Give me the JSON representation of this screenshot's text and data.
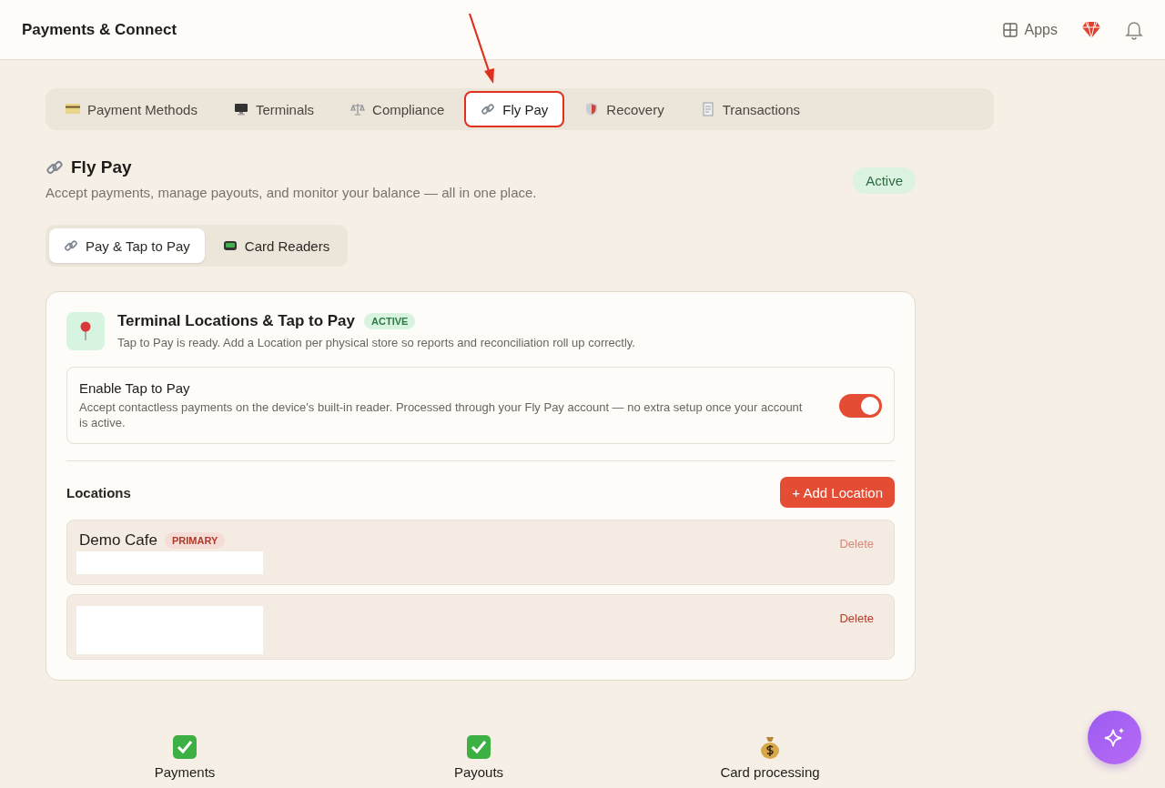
{
  "header": {
    "title": "Payments & Connect",
    "apps_label": "Apps"
  },
  "tabs": [
    {
      "label": "Payment Methods",
      "selected": false,
      "annotated": false
    },
    {
      "label": "Terminals",
      "selected": false,
      "annotated": false
    },
    {
      "label": "Compliance",
      "selected": false,
      "annotated": false
    },
    {
      "label": "Fly Pay",
      "selected": true,
      "annotated": true
    },
    {
      "label": "Recovery",
      "selected": false,
      "annotated": false
    },
    {
      "label": "Transactions",
      "selected": false,
      "annotated": false
    }
  ],
  "section": {
    "title": "Fly Pay",
    "subtitle": "Accept payments, manage payouts, and monitor your balance — all in one place.",
    "status": "Active"
  },
  "subtabs": [
    {
      "label": "Pay & Tap to Pay",
      "selected": true
    },
    {
      "label": "Card Readers",
      "selected": false
    }
  ],
  "card": {
    "title": "Terminal Locations & Tap to Pay",
    "badge": "ACTIVE",
    "description": "Tap to Pay is ready. Add a Location per physical store so reports and reconciliation roll up correctly.",
    "toggle": {
      "title": "Enable Tap to Pay",
      "description": "Accept contactless payments on the device's built-in reader. Processed through your Fly Pay account — no extra setup once your account is active.",
      "on": true
    },
    "locations_label": "Locations",
    "add_button": "+ Add Location",
    "locations": [
      {
        "name": "Demo Cafe",
        "badge": "PRIMARY",
        "delete_label": "Delete",
        "disabled": true
      },
      {
        "delete_label": "Delete",
        "disabled": false
      }
    ]
  },
  "stats": [
    {
      "label": "Payments"
    },
    {
      "label": "Payouts"
    },
    {
      "label": "Card processing"
    }
  ]
}
